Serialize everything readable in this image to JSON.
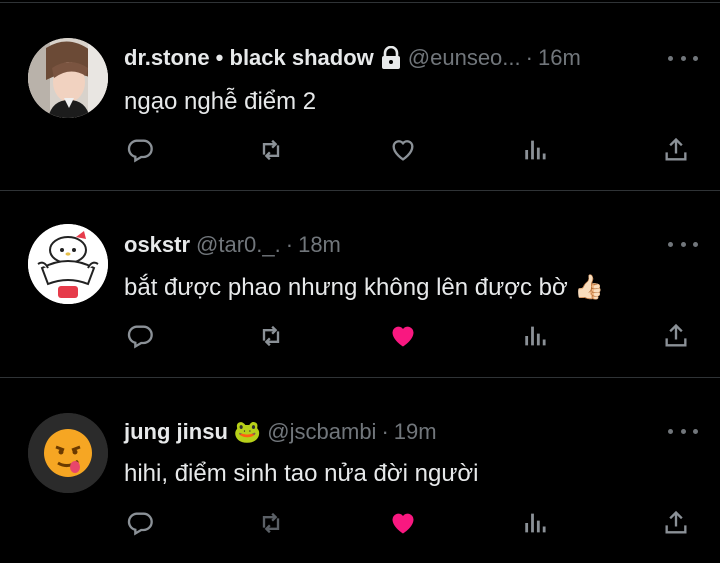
{
  "tweets": [
    {
      "name": "dr.stone • black shadow",
      "handle": "@eunseo...",
      "separator": "·",
      "time": "16m",
      "text": "ngạo nghễ điểm 2",
      "locked": true,
      "liked": false,
      "avatar": "photo-avatar"
    },
    {
      "name": "oskstr",
      "handle": "@tar0._.",
      "separator": "·",
      "time": "18m",
      "text": "bắt được phao nhưng không lên được bờ",
      "emoji": "👍🏻",
      "liked": true,
      "avatar": "cartoon-avatar"
    },
    {
      "name": "jung jinsu",
      "name_emoji": "🐸",
      "handle": "@jscbambi",
      "separator": "·",
      "time": "19m",
      "text": "hihi, điểm sinh tao nửa đời người",
      "liked": true,
      "avatar": "emoji-avatar"
    }
  ],
  "colors": {
    "background": "#000000",
    "text": "#e7e9ea",
    "muted": "#71767b",
    "separator": "#2f3336",
    "like_active": "#f91880"
  },
  "icons": [
    "reply-icon",
    "retweet-icon",
    "like-icon",
    "views-icon",
    "share-icon",
    "lock-icon",
    "more-icon"
  ]
}
